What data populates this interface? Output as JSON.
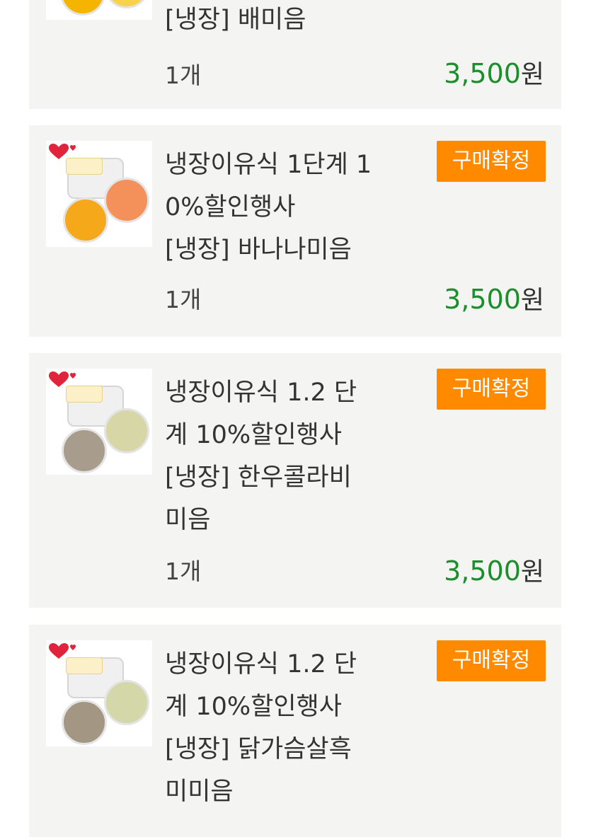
{
  "orders": [
    {
      "title": "[냉장] 배미음",
      "qty": "1개",
      "price": "3,500",
      "currency": "원",
      "thumb_colors": [
        "#f5b400",
        "#f7d24a"
      ]
    },
    {
      "title": "냉장이유식 1단계 1\n0%할인행사\n[냉장] 바나나미음",
      "qty": "1개",
      "price": "3,500",
      "currency": "원",
      "button": "구매확정",
      "thumb_colors": [
        "#f5a81a",
        "#f4905a"
      ]
    },
    {
      "title": "냉장이유식 1.2 단\n계 10%할인행사\n[냉장] 한우콜라비\n미음",
      "qty": "1개",
      "price": "3,500",
      "currency": "원",
      "button": "구매확정",
      "thumb_colors": [
        "#a89c8c",
        "#d6d6a6"
      ]
    },
    {
      "title": "냉장이유식 1.2 단\n계 10%할인행사\n[냉장] 닭가슴살흑\n미미음",
      "button": "구매확정",
      "thumb_colors": [
        "#a39784",
        "#d4d7a8"
      ]
    }
  ],
  "colors": {
    "card_bg": "#f4f5f2",
    "price_green": "#1a8f2c",
    "button_orange": "#ff8a00"
  }
}
